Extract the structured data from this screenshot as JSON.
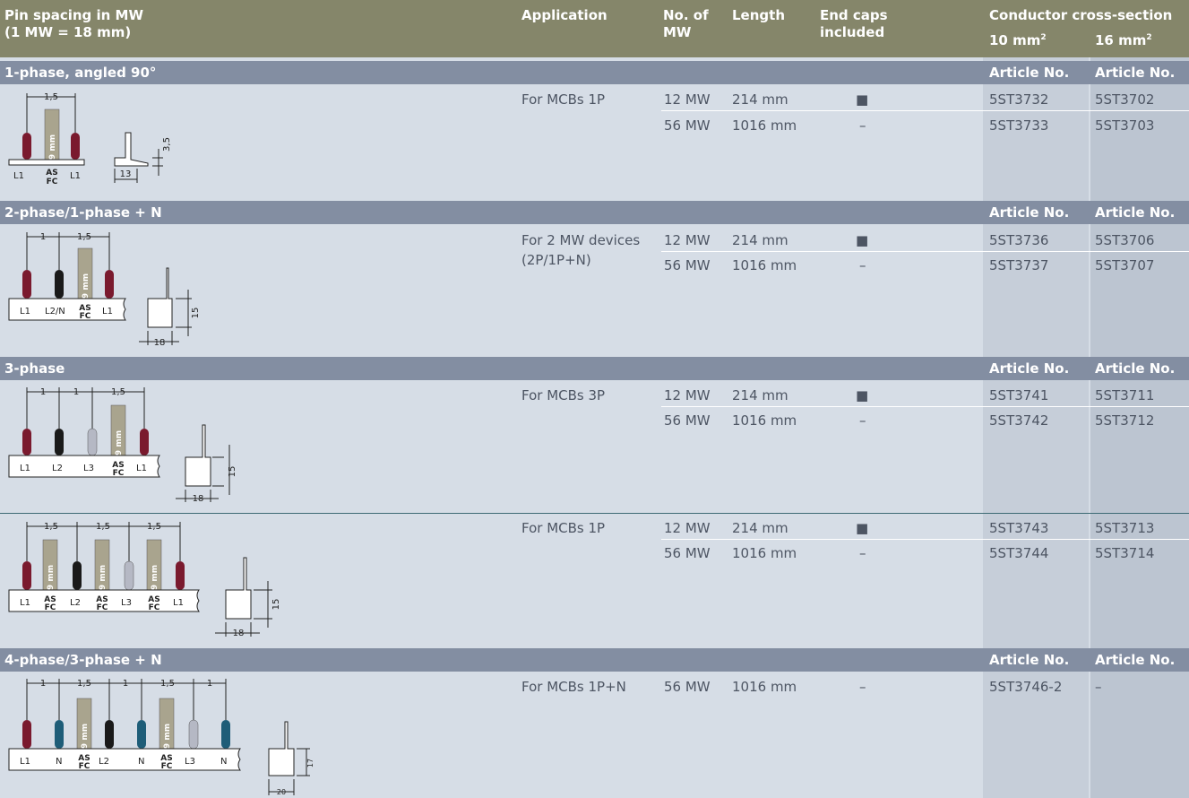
{
  "header": {
    "pin_spacing_line1": "Pin spacing in MW",
    "pin_spacing_line2": "(1 MW = 18 mm)",
    "application": "Application",
    "no_of_mw_line1": "No. of",
    "no_of_mw_line2": "MW",
    "length": "Length",
    "end_caps_line1": "End caps",
    "end_caps_line2": "included",
    "conductor": "Conductor cross-section",
    "cs10_value": "10 mm",
    "cs16_value": "16 mm",
    "cs_exp": "2"
  },
  "article_label": "Article No.",
  "sections": [
    {
      "title": "1-phase, angled 90°",
      "application": "For MCBs 1P",
      "rows": [
        {
          "mw": "12 MW",
          "length": "214 mm",
          "endcaps": "■",
          "a10": "5ST3732",
          "a16": "5ST3702"
        },
        {
          "mw": "56 MW",
          "length": "1016 mm",
          "endcaps": "–",
          "a10": "5ST3733",
          "a16": "5ST3703"
        }
      ]
    },
    {
      "title": "2-phase/1-phase + N",
      "application_line1": "For 2 MW devices",
      "application_line2": "(2P/1P+N)",
      "rows": [
        {
          "mw": "12 MW",
          "length": "214 mm",
          "endcaps": "■",
          "a10": "5ST3736",
          "a16": "5ST3706"
        },
        {
          "mw": "56 MW",
          "length": "1016 mm",
          "endcaps": "–",
          "a10": "5ST3737",
          "a16": "5ST3707"
        }
      ]
    },
    {
      "title": "3-phase",
      "application": "For MCBs 3P",
      "rows": [
        {
          "mw": "12 MW",
          "length": "214 mm",
          "endcaps": "■",
          "a10": "5ST3741",
          "a16": "5ST3711"
        },
        {
          "mw": "56 MW",
          "length": "1016 mm",
          "endcaps": "–",
          "a10": "5ST3742",
          "a16": "5ST3712"
        }
      ]
    },
    {
      "title": "",
      "application": "For MCBs 1P",
      "rows": [
        {
          "mw": "12 MW",
          "length": "214 mm",
          "endcaps": "■",
          "a10": "5ST3743",
          "a16": "5ST3713"
        },
        {
          "mw": "56 MW",
          "length": "1016 mm",
          "endcaps": "–",
          "a10": "5ST3744",
          "a16": "5ST3714"
        }
      ]
    },
    {
      "title": "4-phase/3-phase + N",
      "application": "For MCBs 1P+N",
      "rows": [
        {
          "mw": "56 MW",
          "length": "1016 mm",
          "endcaps": "–",
          "a10": "5ST3746-2",
          "a16": "–"
        }
      ]
    }
  ],
  "diagrams": {
    "d1": {
      "dim_top": "1,5",
      "labels": [
        "L1",
        "AS",
        "FC",
        "L1"
      ],
      "pin_text": "9 mm",
      "side_w": "13",
      "side_h": "3,5"
    },
    "d2": {
      "dim_a": "1",
      "dim_b": "1,5",
      "labels": [
        "L1",
        "L2/N",
        "AS",
        "FC",
        "L1"
      ],
      "pin_text": "9 mm",
      "side_w": "18",
      "side_h": "15"
    },
    "d3": {
      "dim_a": "1",
      "dim_b": "1",
      "dim_c": "1,5",
      "labels": [
        "L1",
        "L2",
        "L3",
        "AS",
        "FC",
        "L1"
      ],
      "pin_text": "9 mm",
      "side_w": "18",
      "side_h": "15"
    },
    "d4": {
      "dim": "1,5",
      "labels": [
        "L1",
        "AS",
        "FC",
        "L2",
        "AS",
        "FC",
        "L3",
        "AS",
        "FC",
        "L1"
      ],
      "pin_text": "9 mm",
      "side_w": "18",
      "side_h": "15"
    },
    "d5": {
      "dim_a": "1",
      "dim_b": "1,5",
      "labels": [
        "L1",
        "N",
        "AS",
        "FC",
        "L2",
        "N",
        "AS",
        "FC",
        "L3",
        "N"
      ],
      "pin_text": "9 mm",
      "side_w": "20",
      "side_h": "17"
    }
  },
  "colors": {
    "header": "#85866a",
    "bar": "#838ea2",
    "body": "#d6dde6",
    "red_pin": "#7a1a2e",
    "black_pin": "#1a1a1a",
    "grey_pin": "#b5b8c4",
    "blue_pin": "#1e5d78",
    "tan_pin": "#a9a48e"
  }
}
